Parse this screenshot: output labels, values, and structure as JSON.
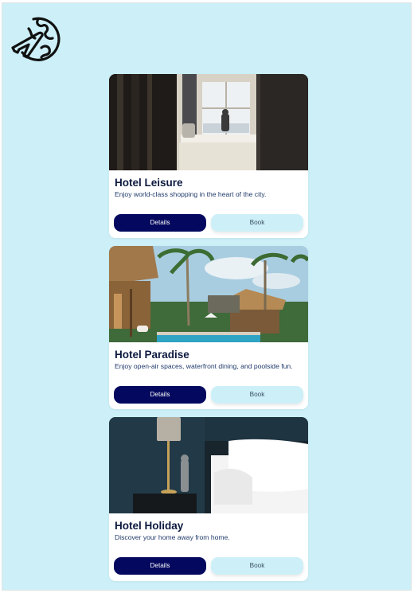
{
  "logo": {
    "icon": "globe-airplane-icon"
  },
  "hotels": [
    {
      "name": "Hotel Leisure",
      "description": "Enjoy world-class shopping in the heart of the city.",
      "image": "hotel-room-window-photo",
      "details_label": "Details",
      "book_label": "Book"
    },
    {
      "name": "Hotel Paradise",
      "description": "Enjoy open-air spaces, waterfront dining, and poolside fun.",
      "image": "tropical-resort-pool-photo",
      "details_label": "Details",
      "book_label": "Book"
    },
    {
      "name": "Hotel Holiday",
      "description": "Discover your home away from home.",
      "image": "bedroom-lamp-photo",
      "details_label": "Details",
      "book_label": "Book"
    }
  ],
  "colors": {
    "background": "#cdf0f8",
    "primary": "#04095f",
    "card": "#ffffff",
    "title": "#0d1a40"
  }
}
